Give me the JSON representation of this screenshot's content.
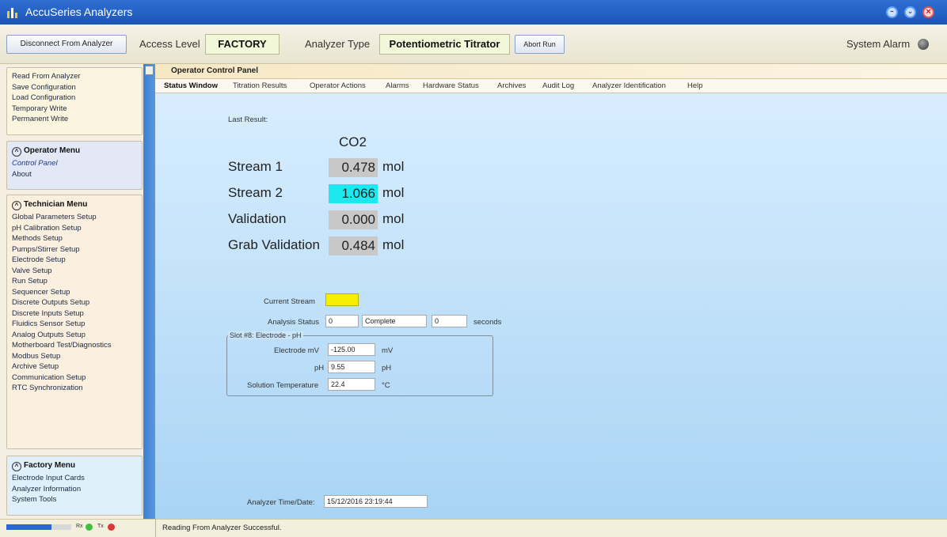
{
  "window": {
    "title": "AccuSeries Analyzers",
    "controls": [
      "minimize",
      "maximize",
      "close"
    ]
  },
  "toolbar": {
    "disconnect_label": "Disconnect From Analyzer",
    "access_level_label": "Access Level",
    "access_level_value": "FACTORY",
    "analyzer_type_label": "Analyzer Type",
    "analyzer_type_value": "Potentiometric Titrator",
    "abort_label": "Abort Run",
    "system_alarm_label": "System Alarm"
  },
  "sidebar": {
    "file_items": [
      "Read From Analyzer",
      "Save Configuration",
      "Load Configuration",
      "Temporary Write",
      "Permanent Write"
    ],
    "operator_menu": {
      "title": "Operator Menu",
      "items": [
        "Control Panel",
        "About"
      ],
      "active": "Control Panel"
    },
    "technician_menu": {
      "title": "Technician Menu",
      "items": [
        "Global Parameters Setup",
        "pH Calibration Setup",
        "Methods Setup",
        "Pumps/Stirrer Setup",
        "Electrode Setup",
        "Valve Setup",
        "Run Setup",
        "Sequencer Setup",
        "Discrete Outputs Setup",
        "Discrete Inputs Setup",
        "Fluidics Sensor Setup",
        "Analog Outputs Setup",
        "Motherboard Test/Diagnostics",
        "Modbus Setup",
        "Archive Setup",
        "Communication Setup",
        "RTC Synchronization"
      ]
    },
    "factory_menu": {
      "title": "Factory Menu",
      "items": [
        "Electrode Input Cards",
        "Analyzer Information",
        "System Tools"
      ]
    }
  },
  "main": {
    "panel_title": "Operator Control Panel",
    "tabs": [
      "Status Window",
      "Titration Results",
      "Operator Actions",
      "Alarms",
      "Hardware Status",
      "Archives",
      "Audit Log",
      "Analyzer Identification",
      "Help"
    ],
    "active_tab": "Status Window",
    "last_result_label": "Last Result:",
    "column_header": "CO2",
    "results": [
      {
        "name": "Stream 1",
        "value": "0.478",
        "unit": "mol",
        "highlight": "#c8c8c8"
      },
      {
        "name": "Stream 2",
        "value": "1.066",
        "unit": "mol",
        "highlight": "#1de8f0"
      },
      {
        "name": "Validation",
        "value": "0.000",
        "unit": "mol",
        "highlight": "#c8c8c8"
      },
      {
        "name": "Grab Validation",
        "value": "0.484",
        "unit": "mol",
        "highlight": "#c8c8c8"
      }
    ],
    "current_stream_label": "Current Stream",
    "current_stream_color": "#f4f000",
    "analysis_status_label": "Analysis Status",
    "analysis_status_code": "0",
    "analysis_status_text": "Complete",
    "analysis_seconds": "0",
    "seconds_label": "seconds",
    "electrode_group": {
      "title": "Slot #8: Electrode - pH",
      "rows": [
        {
          "label": "Electrode mV",
          "value": "-125.00",
          "unit": "mV"
        },
        {
          "label": "pH",
          "value": "9.55",
          "unit": "pH"
        },
        {
          "label": "Solution Temperature",
          "value": "22.4",
          "unit": "°C"
        }
      ]
    },
    "time_label": "Analyzer Time/Date:",
    "time_value": "15/12/2016 23:19:44"
  },
  "statusbar": {
    "progress_fraction": 0.7,
    "rx_label": "Rx",
    "tx_label": "Tx",
    "rx_color": "#3fbf3f",
    "tx_color": "#d83a3a",
    "message": "Reading From Analyzer Successful."
  },
  "colors": {
    "titlebar": "#1f5fc4",
    "main_bg_top": "#dbefff",
    "main_bg_bottom": "#a9d4f4",
    "accent": "#2a66d8"
  }
}
